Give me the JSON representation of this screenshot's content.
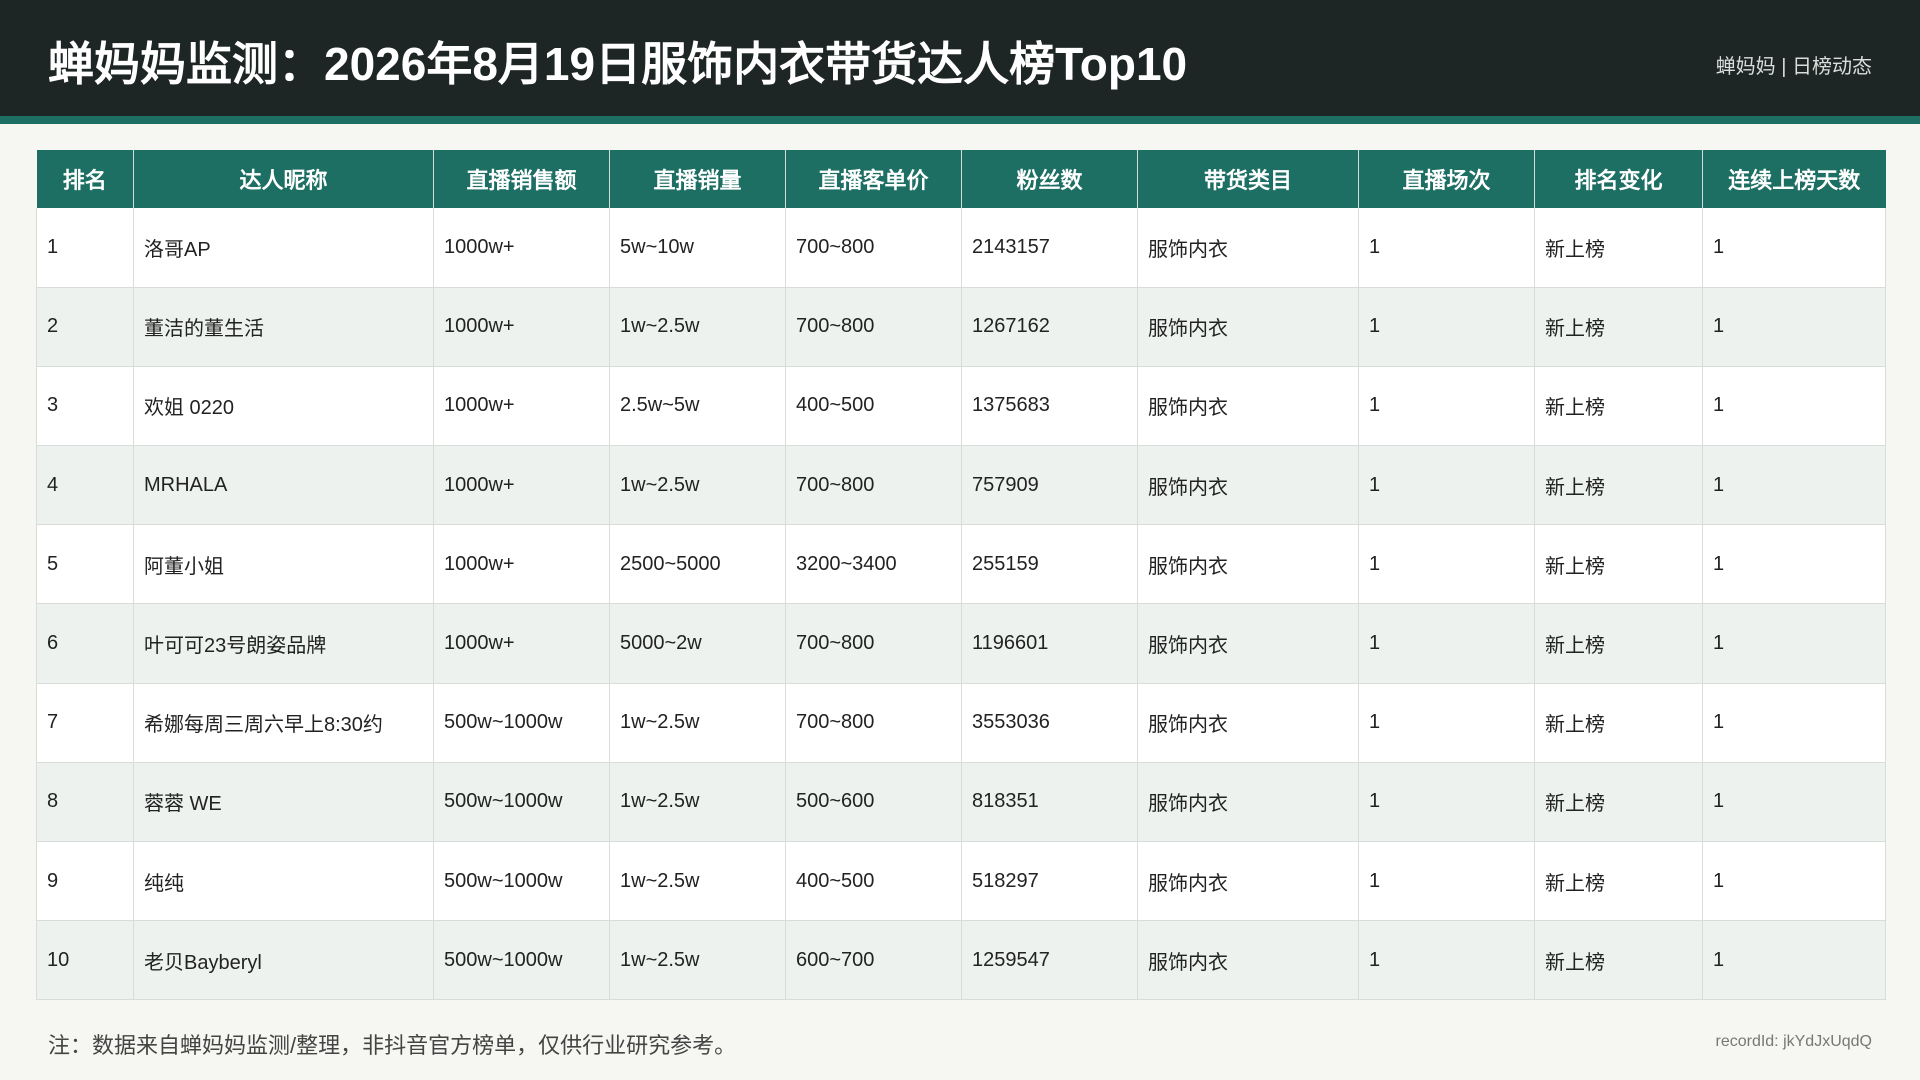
{
  "header": {
    "title": "蝉妈妈监测：2026年8月19日服饰内衣带货达人榜Top10",
    "brand": "蝉妈妈 | 日榜动态"
  },
  "colors": {
    "header_bg": "#1d2624",
    "accent": "#1d6f63",
    "row_alt": "#edf2ef"
  },
  "table": {
    "columns": [
      "排名",
      "达人昵称",
      "直播销售额",
      "直播销量",
      "直播客单价",
      "粉丝数",
      "带货类目",
      "直播场次",
      "排名变化",
      "连续上榜天数"
    ],
    "rows": [
      [
        "1",
        "洛哥AP",
        "1000w+",
        "5w~10w",
        "700~800",
        "2143157",
        "服饰内衣",
        "1",
        "新上榜",
        "1"
      ],
      [
        "2",
        "董洁的董生活",
        "1000w+",
        "1w~2.5w",
        "700~800",
        "1267162",
        "服饰内衣",
        "1",
        "新上榜",
        "1"
      ],
      [
        "3",
        "欢姐 0220",
        "1000w+",
        "2.5w~5w",
        "400~500",
        "1375683",
        "服饰内衣",
        "1",
        "新上榜",
        "1"
      ],
      [
        "4",
        "MRHALA",
        "1000w+",
        "1w~2.5w",
        "700~800",
        "757909",
        "服饰内衣",
        "1",
        "新上榜",
        "1"
      ],
      [
        "5",
        "阿董小姐",
        "1000w+",
        "2500~5000",
        "3200~3400",
        "255159",
        "服饰内衣",
        "1",
        "新上榜",
        "1"
      ],
      [
        "6",
        "叶可可23号朗姿品牌",
        "1000w+",
        "5000~2w",
        "700~800",
        "1196601",
        "服饰内衣",
        "1",
        "新上榜",
        "1"
      ],
      [
        "7",
        "希娜每周三周六早上8:30约",
        "500w~1000w",
        "1w~2.5w",
        "700~800",
        "3553036",
        "服饰内衣",
        "1",
        "新上榜",
        "1"
      ],
      [
        "8",
        "蓉蓉 WE",
        "500w~1000w",
        "1w~2.5w",
        "500~600",
        "818351",
        "服饰内衣",
        "1",
        "新上榜",
        "1"
      ],
      [
        "9",
        "纯纯",
        "500w~1000w",
        "1w~2.5w",
        "400~500",
        "518297",
        "服饰内衣",
        "1",
        "新上榜",
        "1"
      ],
      [
        "10",
        "老贝Bayberyl",
        "500w~1000w",
        "1w~2.5w",
        "600~700",
        "1259547",
        "服饰内衣",
        "1",
        "新上榜",
        "1"
      ]
    ]
  },
  "footer": {
    "note": "注：数据来自蝉妈妈监测/整理，非抖音官方榜单，仅供行业研究参考。",
    "record": "recordId: jkYdJxUqdQ"
  }
}
